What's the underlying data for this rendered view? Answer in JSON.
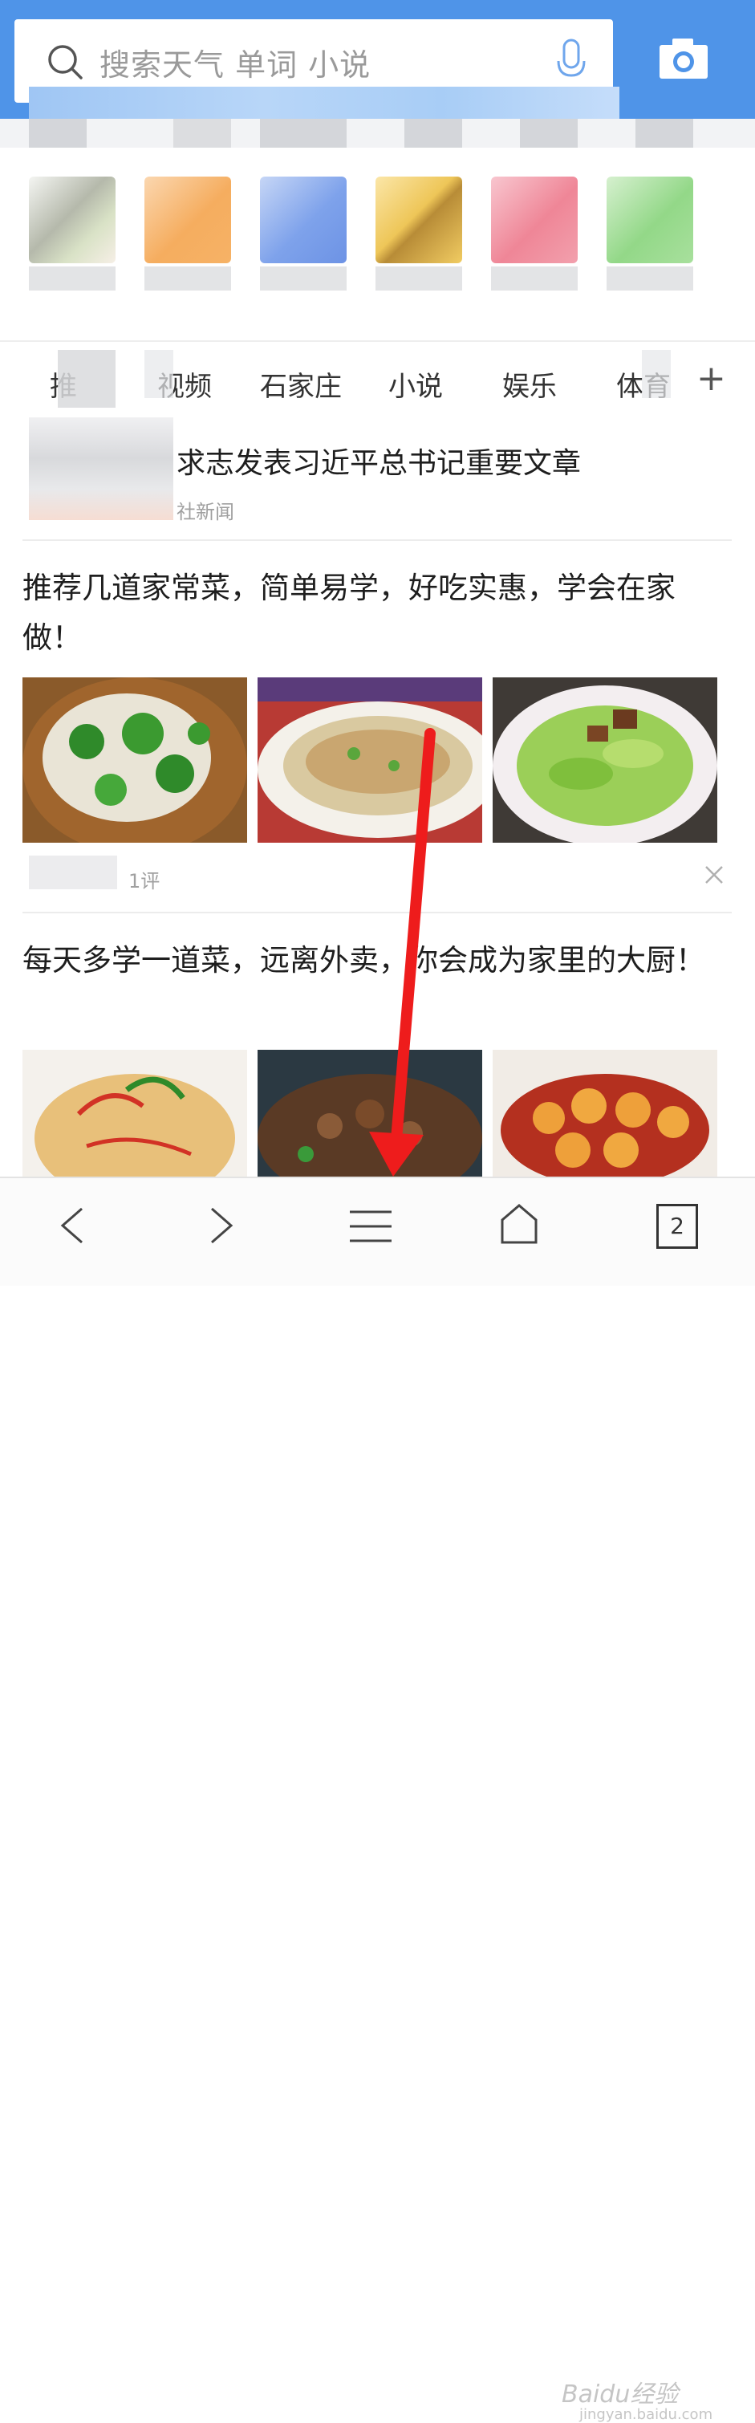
{
  "search": {
    "placeholder": "搜索天气 单词 小说"
  },
  "tabs": [
    {
      "label": "推"
    },
    {
      "label": "视频"
    },
    {
      "label": "石家庄"
    },
    {
      "label": "小说"
    },
    {
      "label": "娱乐"
    },
    {
      "label": "体育"
    }
  ],
  "tab_add_label": "+",
  "feed": {
    "item1": {
      "headline": "求志发表习近平总书记重要文章",
      "source": "社新闻"
    },
    "item2": {
      "title": "推荐几道家常菜，简单易学，好吃实惠，学会在家做！",
      "comments": "1评"
    },
    "item3": {
      "title": "每天多学一道菜，远离外卖，你会成为家里的大厨！"
    }
  },
  "bottom_nav": {
    "tab_count": "2"
  },
  "watermark": {
    "brand": "Baidu经验",
    "url": "jingyan.baidu.com"
  },
  "colors": {
    "header_blue": "#4f94e8",
    "arrow_red": "#ee1c1c"
  }
}
